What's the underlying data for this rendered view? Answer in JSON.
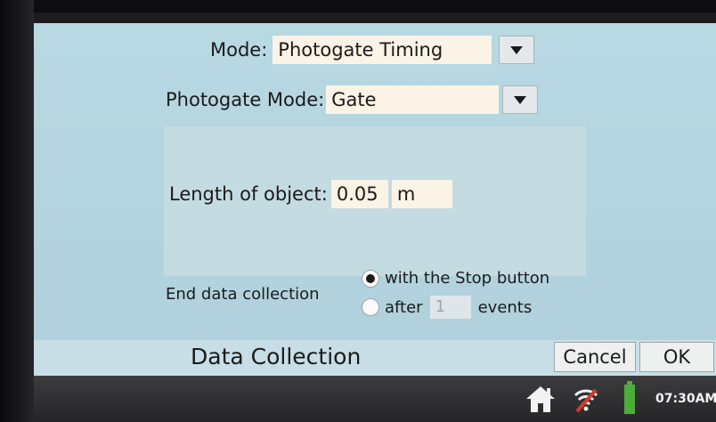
{
  "mode": {
    "label": "Mode:",
    "value": "Photogate Timing"
  },
  "photogate_mode": {
    "label": "Photogate Mode:",
    "value": "Gate"
  },
  "object_length": {
    "label": "Length of object:",
    "value": "0.05",
    "unit": "m"
  },
  "end_collection": {
    "label": "End data collection",
    "option_stop": "with the Stop button",
    "option_after_prefix": "after",
    "option_after_value": "1",
    "option_after_suffix": "events",
    "selected": "with the Stop button"
  },
  "bottom_bar": {
    "title": "Data Collection",
    "cancel_label": "Cancel",
    "ok_label": "OK"
  },
  "status_bar": {
    "time": "07:30AM"
  },
  "colors": {
    "screen_bg": "#b8d8e2",
    "field_bg": "#fbf3e6",
    "battery": "#4cae38",
    "wifi_alert": "#d23a2a"
  },
  "icons": [
    "dropdown-arrow-icon",
    "home-icon",
    "wifi-icon",
    "battery-icon"
  ]
}
